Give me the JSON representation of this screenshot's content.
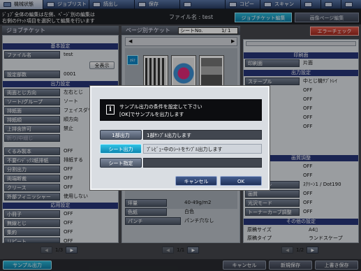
{
  "top_tabs": [
    "機械状態",
    "ジョブリスト",
    "読出し",
    "保存",
    "",
    "コピー",
    "スキャン"
  ],
  "header": {
    "message_1": "ｼﾞｮﾌﾞ全体の編集は左側、ﾍﾟｰｼﾞ別の編集は",
    "message_2": "右側のﾁｹｯﾄ項目を選択して編集を行います",
    "file_name": "ファイル名 : test",
    "tab_job_edit": "ジョブチケット編集",
    "tab_page_edit": "画像ページ編集"
  },
  "left": {
    "title": "ジョブチケット",
    "basic": {
      "header": "基本設定",
      "file_name_label": "ファイル名",
      "file_name_value": "test",
      "show_all": "全表示",
      "copies_label": "設定部数",
      "copies_value": "0001"
    },
    "output": {
      "header": "出力設定",
      "rows": [
        {
          "label": "両面とじ方向",
          "value": "左右とじ"
        },
        {
          "label": "ソート/グループ",
          "value": "ソート"
        },
        {
          "label": "排紙面",
          "value": "フェイスダウン"
        },
        {
          "label": "排紙順",
          "value": "順方向"
        },
        {
          "label": "上排含許可",
          "value": "禁止"
        },
        {
          "label": "折り/中綴じ",
          "value": ""
        },
        {
          "label": "くるみ製本",
          "value": "OFF"
        },
        {
          "label": "不要ｲﾝﾃﾞｯｸｽ紙排紙",
          "value": "排紙する"
        },
        {
          "label": "分割出力",
          "value": "OFF"
        },
        {
          "label": "両端断裁",
          "value": "OFF"
        },
        {
          "label": "クリース",
          "value": "OFF"
        },
        {
          "label": "外部フィニッシャー",
          "value": "使用しない"
        }
      ]
    },
    "applied": {
      "header": "応用設定",
      "rows": [
        {
          "label": "小冊子",
          "value": "OFF"
        },
        {
          "label": "無線とじ",
          "value": "OFF"
        },
        {
          "label": "集約",
          "value": "OFF"
        },
        {
          "label": "リピート",
          "value": "OFF"
        }
      ]
    },
    "pager": {
      "prev": "◀",
      "text": "1/3",
      "next": "▶"
    }
  },
  "center": {
    "title": "ページ別チケット",
    "sheet_label": "シートNo.",
    "sheet_value": "1/  1",
    "thumb_label": "ｵﾓﾃ",
    "rows": [
      {
        "label": "坪量",
        "value": "40-49g/m2"
      },
      {
        "label": "色紙",
        "value": "白色"
      },
      {
        "label": "パンチ",
        "value": "パンチ穴なし"
      }
    ],
    "pager": {
      "prev": "◀",
      "text": "1/1",
      "next": "▶"
    }
  },
  "right": {
    "error_check": "エラーチェック",
    "print_side": {
      "header": "印刷面",
      "label": "印刷面",
      "value": "片面"
    },
    "output": {
      "header": "出力設定",
      "rows": [
        {
          "label": "ステープル",
          "value": "中とじ機ｻﾌﾞﾄﾚｲ"
        },
        {
          "value": "OFF"
        },
        {
          "value": "OFF"
        },
        {
          "value": "OFF"
        },
        {
          "value": "OFF"
        },
        {
          "value": "OFF"
        }
      ]
    },
    "quality": {
      "header": "画質調整",
      "rows": [
        {
          "value": "OFF"
        },
        {
          "value": "OFF"
        },
        {
          "label": "スクリーン",
          "value": "ｽｸﾘｰﾝ1 / Dot190"
        },
        {
          "label": "画質",
          "value": "OFF"
        },
        {
          "label": "光沢モード",
          "value": "OFF"
        },
        {
          "label": "トーナーカーブ調整",
          "value": "OFF"
        }
      ]
    },
    "other": {
      "header": "その他の設定",
      "rows": [
        {
          "label": "原稿サイズ",
          "value": "A4▯"
        },
        {
          "label": "原稿タイプ",
          "value": "ランドスケープ"
        }
      ]
    },
    "pager": {
      "prev": "◀",
      "text": "1/2",
      "next": "▶"
    }
  },
  "bottom": {
    "sample_output": "サンプル出力",
    "cancel": "キャンセル",
    "new_save": "新規保存",
    "overwrite_save": "上書き保存"
  },
  "dialog": {
    "message_1": "サンプル出力の条件を設定して下さい",
    "message_2": "[OK]でサンプルを出力します",
    "options": [
      {
        "button": "1部出力",
        "desc": "1部ｻﾝﾌﾟﾙ出力します"
      },
      {
        "button": "シート出力",
        "desc": "ﾌﾟﾚﾋﾞｭｰ中のｼｰﾄをｻﾝﾌﾟﾙ出力します"
      },
      {
        "button": "シート指定",
        "desc": ""
      }
    ],
    "cancel": "キャンセル",
    "ok": "OK"
  },
  "colors": {
    "accent": "#0f86b0",
    "section_header": "#27367a",
    "error": "#a42a20"
  }
}
